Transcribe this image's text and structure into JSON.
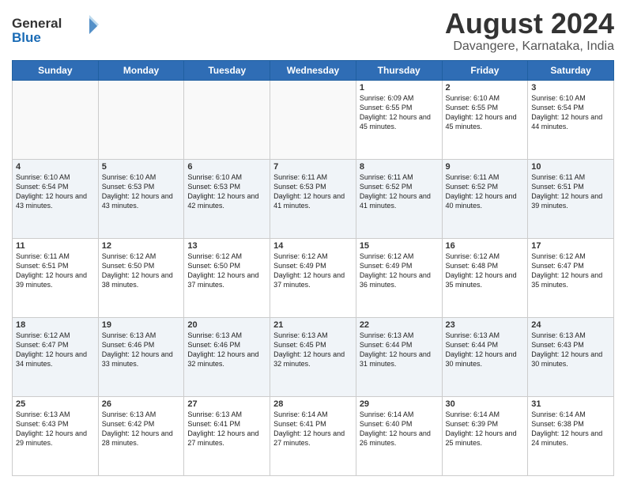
{
  "header": {
    "logo_general": "General",
    "logo_blue": "Blue",
    "month": "August 2024",
    "location": "Davangere, Karnataka, India"
  },
  "weekdays": [
    "Sunday",
    "Monday",
    "Tuesday",
    "Wednesday",
    "Thursday",
    "Friday",
    "Saturday"
  ],
  "weeks": [
    [
      {
        "day": "",
        "info": ""
      },
      {
        "day": "",
        "info": ""
      },
      {
        "day": "",
        "info": ""
      },
      {
        "day": "",
        "info": ""
      },
      {
        "day": "1",
        "info": "Sunrise: 6:09 AM\nSunset: 6:55 PM\nDaylight: 12 hours and 45 minutes."
      },
      {
        "day": "2",
        "info": "Sunrise: 6:10 AM\nSunset: 6:55 PM\nDaylight: 12 hours and 45 minutes."
      },
      {
        "day": "3",
        "info": "Sunrise: 6:10 AM\nSunset: 6:54 PM\nDaylight: 12 hours and 44 minutes."
      }
    ],
    [
      {
        "day": "4",
        "info": "Sunrise: 6:10 AM\nSunset: 6:54 PM\nDaylight: 12 hours and 43 minutes."
      },
      {
        "day": "5",
        "info": "Sunrise: 6:10 AM\nSunset: 6:53 PM\nDaylight: 12 hours and 43 minutes."
      },
      {
        "day": "6",
        "info": "Sunrise: 6:10 AM\nSunset: 6:53 PM\nDaylight: 12 hours and 42 minutes."
      },
      {
        "day": "7",
        "info": "Sunrise: 6:11 AM\nSunset: 6:53 PM\nDaylight: 12 hours and 41 minutes."
      },
      {
        "day": "8",
        "info": "Sunrise: 6:11 AM\nSunset: 6:52 PM\nDaylight: 12 hours and 41 minutes."
      },
      {
        "day": "9",
        "info": "Sunrise: 6:11 AM\nSunset: 6:52 PM\nDaylight: 12 hours and 40 minutes."
      },
      {
        "day": "10",
        "info": "Sunrise: 6:11 AM\nSunset: 6:51 PM\nDaylight: 12 hours and 39 minutes."
      }
    ],
    [
      {
        "day": "11",
        "info": "Sunrise: 6:11 AM\nSunset: 6:51 PM\nDaylight: 12 hours and 39 minutes."
      },
      {
        "day": "12",
        "info": "Sunrise: 6:12 AM\nSunset: 6:50 PM\nDaylight: 12 hours and 38 minutes."
      },
      {
        "day": "13",
        "info": "Sunrise: 6:12 AM\nSunset: 6:50 PM\nDaylight: 12 hours and 37 minutes."
      },
      {
        "day": "14",
        "info": "Sunrise: 6:12 AM\nSunset: 6:49 PM\nDaylight: 12 hours and 37 minutes."
      },
      {
        "day": "15",
        "info": "Sunrise: 6:12 AM\nSunset: 6:49 PM\nDaylight: 12 hours and 36 minutes."
      },
      {
        "day": "16",
        "info": "Sunrise: 6:12 AM\nSunset: 6:48 PM\nDaylight: 12 hours and 35 minutes."
      },
      {
        "day": "17",
        "info": "Sunrise: 6:12 AM\nSunset: 6:47 PM\nDaylight: 12 hours and 35 minutes."
      }
    ],
    [
      {
        "day": "18",
        "info": "Sunrise: 6:12 AM\nSunset: 6:47 PM\nDaylight: 12 hours and 34 minutes."
      },
      {
        "day": "19",
        "info": "Sunrise: 6:13 AM\nSunset: 6:46 PM\nDaylight: 12 hours and 33 minutes."
      },
      {
        "day": "20",
        "info": "Sunrise: 6:13 AM\nSunset: 6:46 PM\nDaylight: 12 hours and 32 minutes."
      },
      {
        "day": "21",
        "info": "Sunrise: 6:13 AM\nSunset: 6:45 PM\nDaylight: 12 hours and 32 minutes."
      },
      {
        "day": "22",
        "info": "Sunrise: 6:13 AM\nSunset: 6:44 PM\nDaylight: 12 hours and 31 minutes."
      },
      {
        "day": "23",
        "info": "Sunrise: 6:13 AM\nSunset: 6:44 PM\nDaylight: 12 hours and 30 minutes."
      },
      {
        "day": "24",
        "info": "Sunrise: 6:13 AM\nSunset: 6:43 PM\nDaylight: 12 hours and 30 minutes."
      }
    ],
    [
      {
        "day": "25",
        "info": "Sunrise: 6:13 AM\nSunset: 6:43 PM\nDaylight: 12 hours and 29 minutes."
      },
      {
        "day": "26",
        "info": "Sunrise: 6:13 AM\nSunset: 6:42 PM\nDaylight: 12 hours and 28 minutes."
      },
      {
        "day": "27",
        "info": "Sunrise: 6:13 AM\nSunset: 6:41 PM\nDaylight: 12 hours and 27 minutes."
      },
      {
        "day": "28",
        "info": "Sunrise: 6:14 AM\nSunset: 6:41 PM\nDaylight: 12 hours and 27 minutes."
      },
      {
        "day": "29",
        "info": "Sunrise: 6:14 AM\nSunset: 6:40 PM\nDaylight: 12 hours and 26 minutes."
      },
      {
        "day": "30",
        "info": "Sunrise: 6:14 AM\nSunset: 6:39 PM\nDaylight: 12 hours and 25 minutes."
      },
      {
        "day": "31",
        "info": "Sunrise: 6:14 AM\nSunset: 6:38 PM\nDaylight: 12 hours and 24 minutes."
      }
    ]
  ]
}
